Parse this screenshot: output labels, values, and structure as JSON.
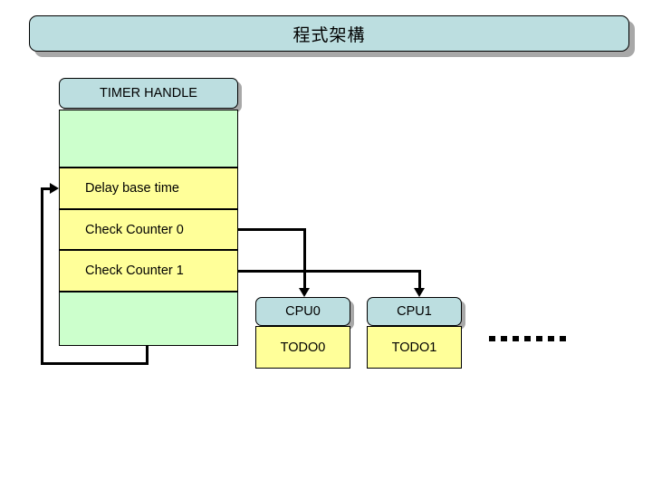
{
  "slide": {
    "title": "程式架構"
  },
  "timer_handle": {
    "header_label": "TIMER HANDLE",
    "rows": [
      {
        "label": "",
        "fill": "green"
      },
      {
        "label": "Delay base time",
        "fill": "yellow"
      },
      {
        "label": "Check Counter 0",
        "fill": "yellow"
      },
      {
        "label": "Check Counter 1",
        "fill": "yellow"
      },
      {
        "label": "",
        "fill": "green"
      }
    ]
  },
  "cpus": [
    {
      "header_label": "CPU0",
      "body_label": "TODO0"
    },
    {
      "header_label": "CPU1",
      "body_label": "TODO1"
    }
  ],
  "continuation": {
    "marker": "dashed-line"
  },
  "colors": {
    "title_fill": "#BCDEE0",
    "header_fill": "#BCDEE0",
    "green_fill": "#CCFFCC",
    "yellow_fill": "#FFFF99",
    "shadow": "#A8A8A8",
    "outline": "#000000"
  }
}
